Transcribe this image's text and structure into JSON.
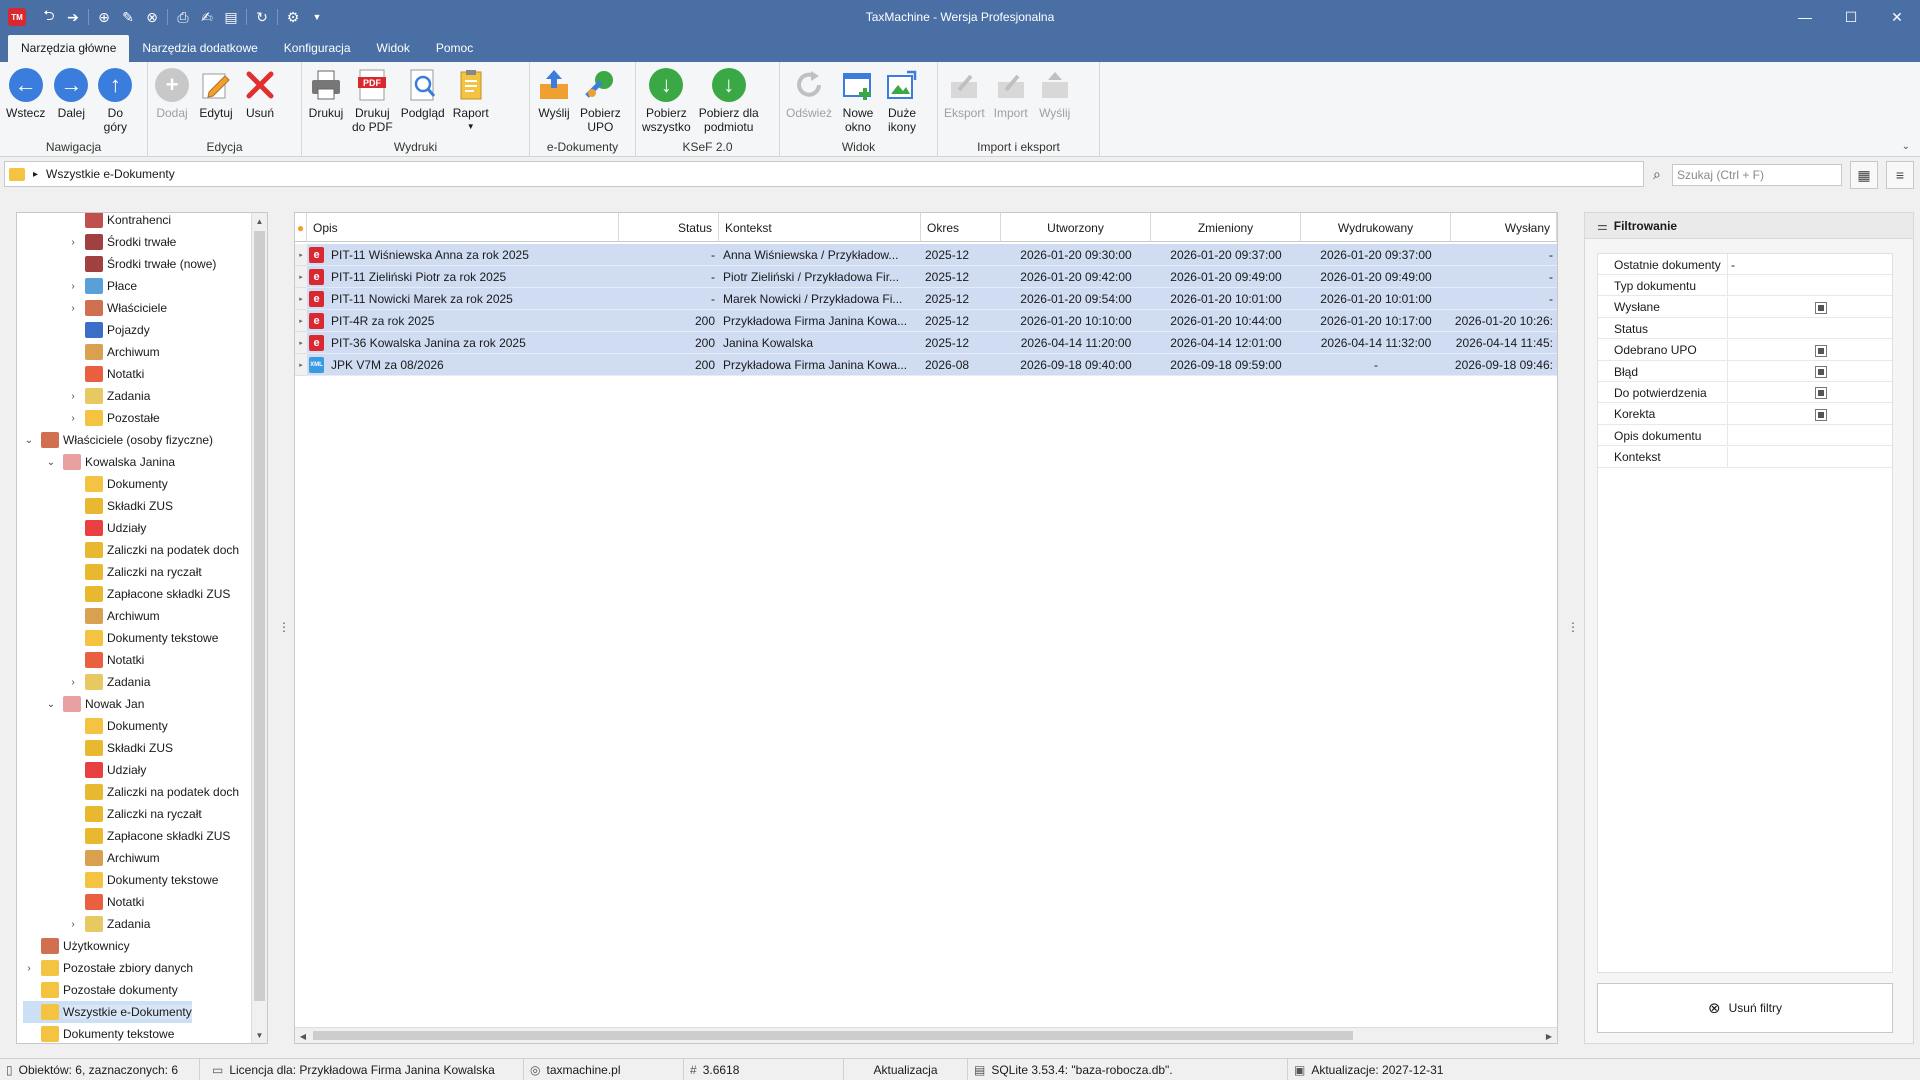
{
  "window": {
    "title": "TaxMachine  -  Wersja Profesjonalna",
    "logo": "TM"
  },
  "ribbon_tabs": [
    "Narzędzia główne",
    "Narzędzia dodatkowe",
    "Konfiguracja",
    "Widok",
    "Pomoc"
  ],
  "ribbon": {
    "groups": [
      {
        "label": "Nawigacja",
        "buttons": [
          {
            "label": "Wstecz",
            "icon": "arrow-left-icon"
          },
          {
            "label": "Dalej",
            "icon": "arrow-right-icon"
          },
          {
            "label": "Do\ngóry",
            "icon": "arrow-up-icon"
          }
        ]
      },
      {
        "label": "Edycja",
        "buttons": [
          {
            "label": "Dodaj",
            "icon": "plus-icon"
          },
          {
            "label": "Edytuj",
            "icon": "pencil-icon"
          },
          {
            "label": "Usuń",
            "icon": "delete-x-icon"
          }
        ]
      },
      {
        "label": "Wydruki",
        "buttons": [
          {
            "label": "Drukuj",
            "icon": "printer-icon"
          },
          {
            "label": "Drukuj\ndo PDF",
            "icon": "pdf-icon"
          },
          {
            "label": "Podgląd",
            "icon": "preview-icon"
          },
          {
            "label": "Raport",
            "icon": "report-icon"
          }
        ]
      },
      {
        "label": "e-Dokumenty",
        "buttons": [
          {
            "label": "Wyślij",
            "icon": "send-icon"
          },
          {
            "label": "Pobierz\nUPO",
            "icon": "download-upo-icon"
          }
        ]
      },
      {
        "label": "KSeF 2.0",
        "buttons": [
          {
            "label": "Pobierz\nwszystko",
            "icon": "download-all-icon"
          },
          {
            "label": "Pobierz dla\npodmiotu",
            "icon": "download-entity-icon"
          }
        ]
      },
      {
        "label": "Widok",
        "buttons": [
          {
            "label": "Odśwież",
            "icon": "refresh-icon"
          },
          {
            "label": "Nowe\nokno",
            "icon": "new-window-icon"
          },
          {
            "label": "Duże\nikony",
            "icon": "large-icons-icon"
          }
        ]
      },
      {
        "label": "Import i eksport",
        "buttons": [
          {
            "label": "Eksport",
            "icon": "export-icon"
          },
          {
            "label": "Import",
            "icon": "import-icon"
          },
          {
            "label": "Wyślij",
            "icon": "send-export-icon"
          }
        ]
      }
    ]
  },
  "address": {
    "path": "Wszystkie e-Dokumenty",
    "search_placeholder": "Szukaj (Ctrl + F)"
  },
  "tree": {
    "items": [
      {
        "label": "Kontrahenci",
        "level": 2,
        "expander": "",
        "icon_color": "#c0504d"
      },
      {
        "label": "Środki trwałe",
        "level": 2,
        "expander": "›",
        "icon_color": "#a04040"
      },
      {
        "label": "Środki trwałe (nowe)",
        "level": 2,
        "expander": "",
        "icon_color": "#a04040"
      },
      {
        "label": "Płace",
        "level": 2,
        "expander": "›",
        "icon_color": "#5aa0d8"
      },
      {
        "label": "Właściciele",
        "level": 2,
        "expander": "›",
        "icon_color": "#d07050"
      },
      {
        "label": "Pojazdy",
        "level": 2,
        "expander": "",
        "icon_color": "#3a6ec8"
      },
      {
        "label": "Archiwum",
        "level": 2,
        "expander": "",
        "icon_color": "#d9a050"
      },
      {
        "label": "Notatki",
        "level": 2,
        "expander": "",
        "icon_color": "#e86040"
      },
      {
        "label": "Zadania",
        "level": 2,
        "expander": "›",
        "icon_color": "#e8c860"
      },
      {
        "label": "Pozostałe",
        "level": 2,
        "expander": "›",
        "icon_color": "#f5c342"
      },
      {
        "label": "Właściciele (osoby fizyczne)",
        "level": 0,
        "expander": "⌄",
        "icon_color": "#d07050"
      },
      {
        "label": "Kowalska Janina",
        "level": 1,
        "expander": "⌄",
        "icon_color": "#e8a0a0"
      },
      {
        "label": "Dokumenty",
        "level": 2,
        "expander": "",
        "icon_color": "#f5c342"
      },
      {
        "label": "Składki ZUS",
        "level": 2,
        "expander": "",
        "icon_color": "#e8b830"
      },
      {
        "label": "Udziały",
        "level": 2,
        "expander": "",
        "icon_color": "#e84040"
      },
      {
        "label": "Zaliczki na podatek doch",
        "level": 2,
        "expander": "",
        "icon_color": "#e8b830"
      },
      {
        "label": "Zaliczki na ryczałt",
        "level": 2,
        "expander": "",
        "icon_color": "#e8b830"
      },
      {
        "label": "Zapłacone składki ZUS",
        "level": 2,
        "expander": "",
        "icon_color": "#e8b830"
      },
      {
        "label": "Archiwum",
        "level": 2,
        "expander": "",
        "icon_color": "#d9a050"
      },
      {
        "label": "Dokumenty tekstowe",
        "level": 2,
        "expander": "",
        "icon_color": "#f5c342"
      },
      {
        "label": "Notatki",
        "level": 2,
        "expander": "",
        "icon_color": "#e86040"
      },
      {
        "label": "Zadania",
        "level": 2,
        "expander": "›",
        "icon_color": "#e8c860"
      },
      {
        "label": "Nowak Jan",
        "level": 1,
        "expander": "⌄",
        "icon_color": "#e8a0a0"
      },
      {
        "label": "Dokumenty",
        "level": 2,
        "expander": "",
        "icon_color": "#f5c342"
      },
      {
        "label": "Składki ZUS",
        "level": 2,
        "expander": "",
        "icon_color": "#e8b830"
      },
      {
        "label": "Udziały",
        "level": 2,
        "expander": "",
        "icon_color": "#e84040"
      },
      {
        "label": "Zaliczki na podatek doch",
        "level": 2,
        "expander": "",
        "icon_color": "#e8b830"
      },
      {
        "label": "Zaliczki na ryczałt",
        "level": 2,
        "expander": "",
        "icon_color": "#e8b830"
      },
      {
        "label": "Zapłacone składki ZUS",
        "level": 2,
        "expander": "",
        "icon_color": "#e8b830"
      },
      {
        "label": "Archiwum",
        "level": 2,
        "expander": "",
        "icon_color": "#d9a050"
      },
      {
        "label": "Dokumenty tekstowe",
        "level": 2,
        "expander": "",
        "icon_color": "#f5c342"
      },
      {
        "label": "Notatki",
        "level": 2,
        "expander": "",
        "icon_color": "#e86040"
      },
      {
        "label": "Zadania",
        "level": 2,
        "expander": "›",
        "icon_color": "#e8c860"
      },
      {
        "label": "Użytkownicy",
        "level": 0,
        "expander": "",
        "icon_color": "#d07050"
      },
      {
        "label": "Pozostałe zbiory danych",
        "level": 0,
        "expander": "›",
        "icon_color": "#f5c342"
      },
      {
        "label": "Pozostałe dokumenty",
        "level": 0,
        "expander": "",
        "icon_color": "#f5c342"
      },
      {
        "label": "Wszystkie e-Dokumenty",
        "level": 0,
        "expander": "",
        "icon_color": "#f5c342",
        "selected": true
      },
      {
        "label": "Dokumenty tekstowe",
        "level": 0,
        "expander": "",
        "icon_color": "#f5c342"
      }
    ]
  },
  "grid": {
    "columns": [
      "Opis",
      "Status",
      "Kontekst",
      "Okres",
      "Utworzony",
      "Zmieniony",
      "Wydrukowany",
      "Wysłany"
    ],
    "rows": [
      {
        "icon": "e",
        "opis": "PIT-11 Wiśniewska Anna za rok 2025",
        "status": "-",
        "kontekst": "Anna Wiśniewska / Przykładow...",
        "okres": "2025-12",
        "utworzony": "2026-01-20 09:30:00",
        "zmieniony": "2026-01-20 09:37:00",
        "wydrukowany": "2026-01-20 09:37:00",
        "wyslany": "-"
      },
      {
        "icon": "e",
        "opis": "PIT-11 Zieliński Piotr za rok 2025",
        "status": "-",
        "kontekst": "Piotr Zieliński / Przykładowa Fir...",
        "okres": "2025-12",
        "utworzony": "2026-01-20 09:42:00",
        "zmieniony": "2026-01-20 09:49:00",
        "wydrukowany": "2026-01-20 09:49:00",
        "wyslany": "-"
      },
      {
        "icon": "e",
        "opis": "PIT-11 Nowicki Marek za rok 2025",
        "status": "-",
        "kontekst": "Marek Nowicki / Przykładowa Fi...",
        "okres": "2025-12",
        "utworzony": "2026-01-20 09:54:00",
        "zmieniony": "2026-01-20 10:01:00",
        "wydrukowany": "2026-01-20 10:01:00",
        "wyslany": "-"
      },
      {
        "icon": "e",
        "opis": "PIT-4R za rok 2025",
        "status": "200",
        "kontekst": "Przykładowa Firma Janina Kowa...",
        "okres": "2025-12",
        "utworzony": "2026-01-20 10:10:00",
        "zmieniony": "2026-01-20 10:44:00",
        "wydrukowany": "2026-01-20 10:17:00",
        "wyslany": "2026-01-20 10:26:"
      },
      {
        "icon": "e",
        "opis": "PIT-36 Kowalska Janina za rok 2025",
        "status": "200",
        "kontekst": "Janina Kowalska",
        "okres": "2025-12",
        "utworzony": "2026-04-14 11:20:00",
        "zmieniony": "2026-04-14 12:01:00",
        "wydrukowany": "2026-04-14 11:32:00",
        "wyslany": "2026-04-14 11:45:"
      },
      {
        "icon": "xml",
        "opis": "JPK V7M za 08/2026",
        "status": "200",
        "kontekst": "Przykładowa Firma Janina Kowa...",
        "okres": "2026-08",
        "utworzony": "2026-09-18 09:40:00",
        "zmieniony": "2026-09-18 09:59:00",
        "wydrukowany": "-",
        "wyslany": "2026-09-18 09:46:"
      }
    ]
  },
  "filter": {
    "title": "Filtrowanie",
    "fields": [
      {
        "label": "Ostatnie dokumenty",
        "value": "-",
        "checkbox": false
      },
      {
        "label": "Typ dokumentu",
        "value": "",
        "checkbox": false
      },
      {
        "label": "Wysłane",
        "value": "",
        "checkbox": true
      },
      {
        "label": "Status",
        "value": "",
        "checkbox": false
      },
      {
        "label": "Odebrano UPO",
        "value": "",
        "checkbox": true
      },
      {
        "label": "Błąd",
        "value": "",
        "checkbox": true
      },
      {
        "label": "Do potwierdzenia",
        "value": "",
        "checkbox": true
      },
      {
        "label": "Korekta",
        "value": "",
        "checkbox": true
      },
      {
        "label": "Opis dokumentu",
        "value": "",
        "checkbox": false
      },
      {
        "label": "Kontekst",
        "value": "",
        "checkbox": false
      }
    ],
    "clear_label": "Usuń filtry"
  },
  "statusbar": {
    "objects": "Obiektów: 6, zaznaczonych: 6",
    "license": "Licencja dla: Przykładowa Firma Janina Kowalska",
    "website": "taxmachine.pl",
    "version": "3.6618",
    "update": "Aktualizacja",
    "db": "SQLite 3.53.4: \"baza-robocza.db\".",
    "updates_until": "Aktualizacje: 2027-12-31"
  },
  "colors": {
    "titlebar": "#4a6fa5",
    "selection": "#cfdcf2",
    "accent_red": "#d9282f"
  }
}
